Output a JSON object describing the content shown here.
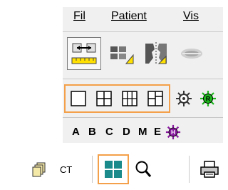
{
  "menu": {
    "items": [
      {
        "label": "Fil",
        "mnemonic": "F"
      },
      {
        "label": "Patient",
        "mnemonic": "P"
      },
      {
        "label": "Vis",
        "mnemonic": "V"
      }
    ]
  },
  "toolbar2": {
    "letters": [
      "A",
      "B",
      "C",
      "D",
      "M",
      "E"
    ]
  },
  "bottom_toolbar": {
    "ct_label": "CT"
  },
  "colors": {
    "highlight": "#f4a04a",
    "layout_grid": "#1a8a8a",
    "star_green": "#1cb81c",
    "star_purple": "#8a1aa0"
  }
}
